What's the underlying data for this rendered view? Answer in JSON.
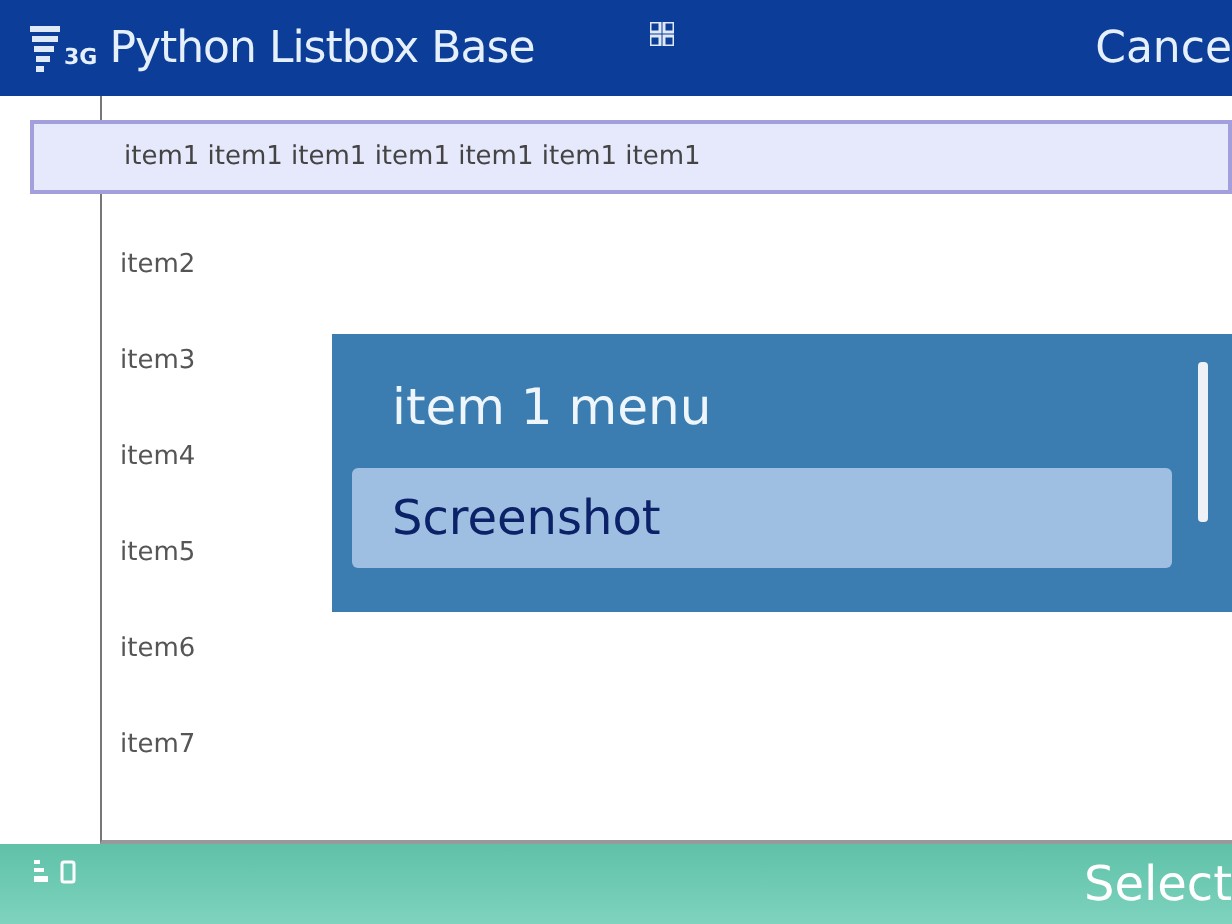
{
  "title_bar": {
    "network": "3G",
    "title": "Python Listbox Base",
    "right_softkey": "Cance"
  },
  "list": {
    "items": [
      {
        "label": "item1 item1 item1 item1 item1 item1 item1",
        "selected": true
      },
      {
        "label": "item2",
        "selected": false
      },
      {
        "label": "item3",
        "selected": false
      },
      {
        "label": "item4",
        "selected": false
      },
      {
        "label": "item5",
        "selected": false
      },
      {
        "label": "item6",
        "selected": false
      },
      {
        "label": "item7",
        "selected": false
      }
    ]
  },
  "popup_menu": {
    "title": "item 1 menu",
    "options": [
      {
        "label": "Screenshot",
        "selected": true
      }
    ]
  },
  "bottom_bar": {
    "right_softkey": "Select"
  }
}
